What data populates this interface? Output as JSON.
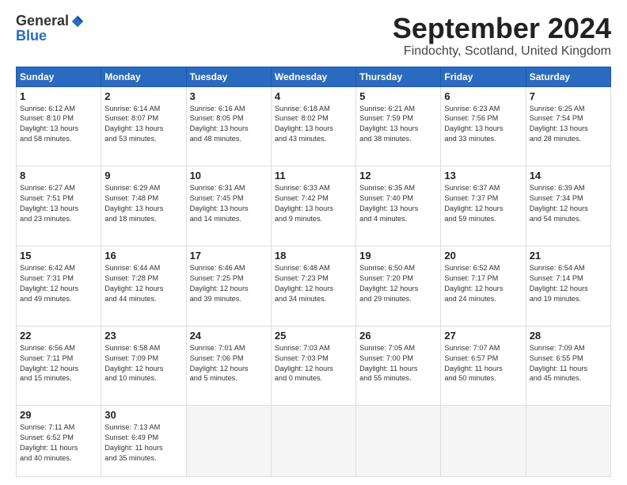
{
  "header": {
    "logo_general": "General",
    "logo_blue": "Blue",
    "title": "September 2024",
    "subtitle": "Findochty, Scotland, United Kingdom"
  },
  "weekdays": [
    "Sunday",
    "Monday",
    "Tuesday",
    "Wednesday",
    "Thursday",
    "Friday",
    "Saturday"
  ],
  "weeks": [
    [
      {
        "day": "1",
        "info": "Sunrise: 6:12 AM\nSunset: 8:10 PM\nDaylight: 13 hours\nand 58 minutes."
      },
      {
        "day": "2",
        "info": "Sunrise: 6:14 AM\nSunset: 8:07 PM\nDaylight: 13 hours\nand 53 minutes."
      },
      {
        "day": "3",
        "info": "Sunrise: 6:16 AM\nSunset: 8:05 PM\nDaylight: 13 hours\nand 48 minutes."
      },
      {
        "day": "4",
        "info": "Sunrise: 6:18 AM\nSunset: 8:02 PM\nDaylight: 13 hours\nand 43 minutes."
      },
      {
        "day": "5",
        "info": "Sunrise: 6:21 AM\nSunset: 7:59 PM\nDaylight: 13 hours\nand 38 minutes."
      },
      {
        "day": "6",
        "info": "Sunrise: 6:23 AM\nSunset: 7:56 PM\nDaylight: 13 hours\nand 33 minutes."
      },
      {
        "day": "7",
        "info": "Sunrise: 6:25 AM\nSunset: 7:54 PM\nDaylight: 13 hours\nand 28 minutes."
      }
    ],
    [
      {
        "day": "8",
        "info": "Sunrise: 6:27 AM\nSunset: 7:51 PM\nDaylight: 13 hours\nand 23 minutes."
      },
      {
        "day": "9",
        "info": "Sunrise: 6:29 AM\nSunset: 7:48 PM\nDaylight: 13 hours\nand 18 minutes."
      },
      {
        "day": "10",
        "info": "Sunrise: 6:31 AM\nSunset: 7:45 PM\nDaylight: 13 hours\nand 14 minutes."
      },
      {
        "day": "11",
        "info": "Sunrise: 6:33 AM\nSunset: 7:42 PM\nDaylight: 13 hours\nand 9 minutes."
      },
      {
        "day": "12",
        "info": "Sunrise: 6:35 AM\nSunset: 7:40 PM\nDaylight: 13 hours\nand 4 minutes."
      },
      {
        "day": "13",
        "info": "Sunrise: 6:37 AM\nSunset: 7:37 PM\nDaylight: 12 hours\nand 59 minutes."
      },
      {
        "day": "14",
        "info": "Sunrise: 6:39 AM\nSunset: 7:34 PM\nDaylight: 12 hours\nand 54 minutes."
      }
    ],
    [
      {
        "day": "15",
        "info": "Sunrise: 6:42 AM\nSunset: 7:31 PM\nDaylight: 12 hours\nand 49 minutes."
      },
      {
        "day": "16",
        "info": "Sunrise: 6:44 AM\nSunset: 7:28 PM\nDaylight: 12 hours\nand 44 minutes."
      },
      {
        "day": "17",
        "info": "Sunrise: 6:46 AM\nSunset: 7:25 PM\nDaylight: 12 hours\nand 39 minutes."
      },
      {
        "day": "18",
        "info": "Sunrise: 6:48 AM\nSunset: 7:23 PM\nDaylight: 12 hours\nand 34 minutes."
      },
      {
        "day": "19",
        "info": "Sunrise: 6:50 AM\nSunset: 7:20 PM\nDaylight: 12 hours\nand 29 minutes."
      },
      {
        "day": "20",
        "info": "Sunrise: 6:52 AM\nSunset: 7:17 PM\nDaylight: 12 hours\nand 24 minutes."
      },
      {
        "day": "21",
        "info": "Sunrise: 6:54 AM\nSunset: 7:14 PM\nDaylight: 12 hours\nand 19 minutes."
      }
    ],
    [
      {
        "day": "22",
        "info": "Sunrise: 6:56 AM\nSunset: 7:11 PM\nDaylight: 12 hours\nand 15 minutes."
      },
      {
        "day": "23",
        "info": "Sunrise: 6:58 AM\nSunset: 7:09 PM\nDaylight: 12 hours\nand 10 minutes."
      },
      {
        "day": "24",
        "info": "Sunrise: 7:01 AM\nSunset: 7:06 PM\nDaylight: 12 hours\nand 5 minutes."
      },
      {
        "day": "25",
        "info": "Sunrise: 7:03 AM\nSunset: 7:03 PM\nDaylight: 12 hours\nand 0 minutes."
      },
      {
        "day": "26",
        "info": "Sunrise: 7:05 AM\nSunset: 7:00 PM\nDaylight: 11 hours\nand 55 minutes."
      },
      {
        "day": "27",
        "info": "Sunrise: 7:07 AM\nSunset: 6:57 PM\nDaylight: 11 hours\nand 50 minutes."
      },
      {
        "day": "28",
        "info": "Sunrise: 7:09 AM\nSunset: 6:55 PM\nDaylight: 11 hours\nand 45 minutes."
      }
    ],
    [
      {
        "day": "29",
        "info": "Sunrise: 7:11 AM\nSunset: 6:52 PM\nDaylight: 11 hours\nand 40 minutes."
      },
      {
        "day": "30",
        "info": "Sunrise: 7:13 AM\nSunset: 6:49 PM\nDaylight: 11 hours\nand 35 minutes."
      },
      {
        "day": "",
        "info": ""
      },
      {
        "day": "",
        "info": ""
      },
      {
        "day": "",
        "info": ""
      },
      {
        "day": "",
        "info": ""
      },
      {
        "day": "",
        "info": ""
      }
    ]
  ]
}
